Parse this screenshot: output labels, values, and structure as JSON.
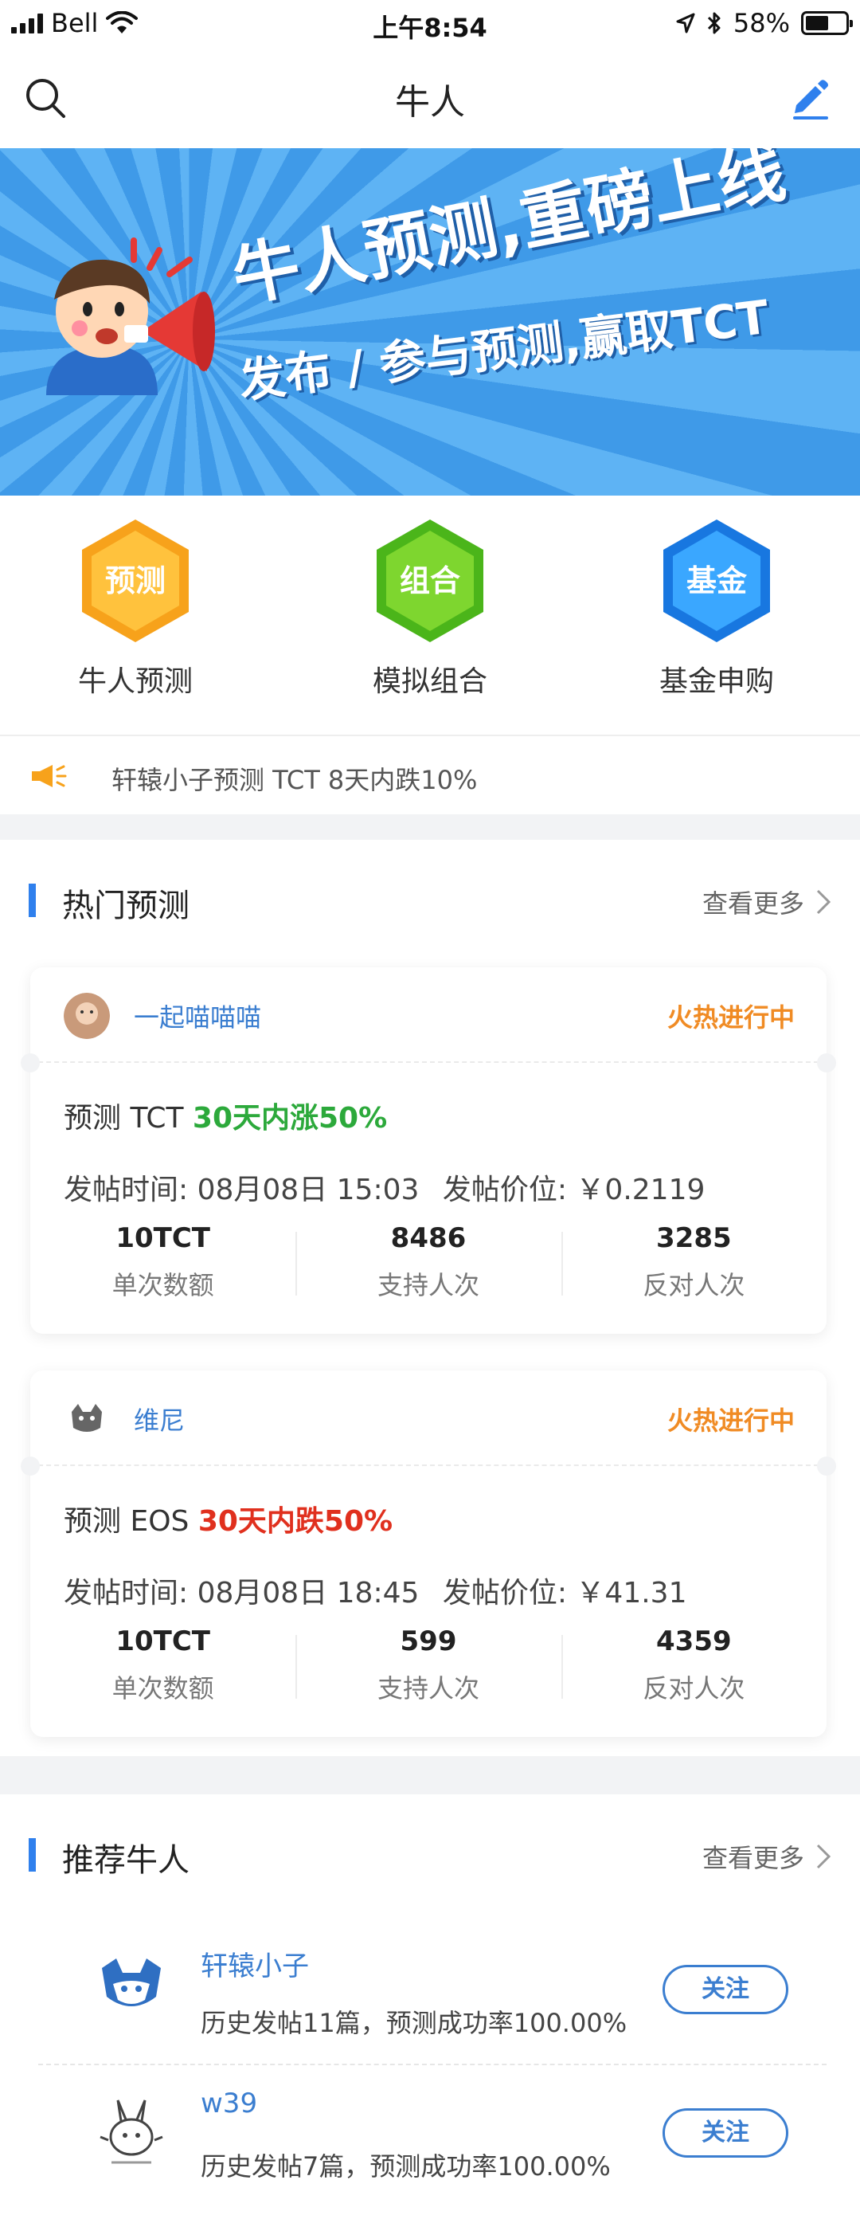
{
  "status_bar": {
    "carrier": "Bell",
    "time": "上午8:54",
    "battery": "58%",
    "battery_level": 0.58
  },
  "nav": {
    "title": "牛人",
    "search_icon": "search-icon",
    "edit_icon": "edit-icon"
  },
  "banner": {
    "title": "牛人预测,重磅上线",
    "subtitle": "发布 / 参与预测,赢取TCT"
  },
  "quick_entries": [
    {
      "badge": "预测",
      "label": "牛人预测",
      "color": "#f7a21b"
    },
    {
      "badge": "组合",
      "label": "模拟组合",
      "color": "#5bc21e"
    },
    {
      "badge": "基金",
      "label": "基金申购",
      "color": "#1d8ff0"
    }
  ],
  "ticker": {
    "icon": "megaphone-icon",
    "text": "轩辕小子预测 TCT 8天内跌10%"
  },
  "hot_section": {
    "title": "热门预测",
    "more": "查看更多"
  },
  "predictions": [
    {
      "user": "一起喵喵喵",
      "status": "火热进行中",
      "prefix": "预测 TCT ",
      "outcome": "30天内涨50%",
      "direction": "up",
      "time_label": "发帖时间: 08月08日 15:03",
      "price_label": "发帖价位: ￥0.2119",
      "stats": [
        {
          "value": "10TCT",
          "label": "单次数额"
        },
        {
          "value": "8486",
          "label": "支持人次"
        },
        {
          "value": "3285",
          "label": "反对人次"
        }
      ]
    },
    {
      "user": "维尼",
      "status": "火热进行中",
      "prefix": "预测 EOS ",
      "outcome": "30天内跌50%",
      "direction": "down",
      "time_label": "发帖时间: 08月08日 18:45",
      "price_label": "发帖价位: ￥41.31",
      "stats": [
        {
          "value": "10TCT",
          "label": "单次数额"
        },
        {
          "value": "599",
          "label": "支持人次"
        },
        {
          "value": "4359",
          "label": "反对人次"
        }
      ]
    }
  ],
  "rec_section": {
    "title": "推荐牛人",
    "more": "查看更多"
  },
  "recommended": [
    {
      "name": "轩辕小子",
      "desc": "历史发帖11篇，预测成功率100.00%",
      "button": "关注"
    },
    {
      "name": "w39",
      "desc": "历史发帖7篇，预测成功率100.00%",
      "button": "关注"
    }
  ]
}
